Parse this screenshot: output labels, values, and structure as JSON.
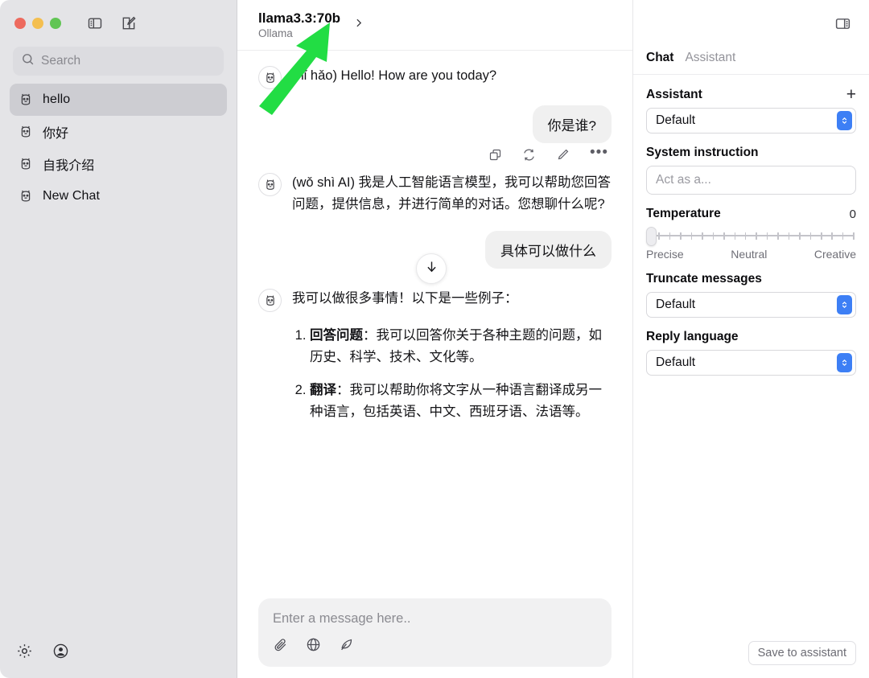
{
  "window": {
    "traffic_lights": [
      "close",
      "minimize",
      "maximize"
    ],
    "toolbar_icons": [
      "sidebar-toggle-icon",
      "compose-icon"
    ]
  },
  "sidebar": {
    "search": {
      "placeholder": "Search",
      "value": "",
      "icon": "search-icon"
    },
    "items": [
      {
        "label": "hello",
        "icon": "llama-icon",
        "active": true
      },
      {
        "label": "你好",
        "icon": "llama-icon",
        "active": false
      },
      {
        "label": "自我介绍",
        "icon": "llama-icon",
        "active": false
      },
      {
        "label": "New Chat",
        "icon": "llama-icon",
        "active": false
      }
    ],
    "footer_icons": [
      "gear-icon",
      "account-icon"
    ]
  },
  "chat_header": {
    "model_name": "llama3.3:70b",
    "provider": "Ollama",
    "chevron": "chevron-right-icon"
  },
  "messages": [
    {
      "role": "assistant",
      "text": "(nǐ hǎo) Hello! How are you today?"
    },
    {
      "role": "user",
      "text": "你是谁?"
    },
    {
      "role": "assistant",
      "text": "(wǒ shì AI) 我是人工智能语言模型，我可以帮助您回答问题，提供信息，并进行简单的对话。您想聊什么呢?",
      "actions": [
        "copy-icon",
        "regenerate-icon",
        "edit-icon",
        "more-options-icon"
      ]
    },
    {
      "role": "user",
      "text": "具体可以做什么"
    },
    {
      "role": "assistant",
      "text": "我可以做很多事情！以下是一些例子：",
      "list": [
        {
          "term": "回答问题",
          "body": "：我可以回答你关于各种主题的问题，如历史、科学、技术、文化等。"
        },
        {
          "term": "翻译",
          "body": "：我可以帮助你将文字从一种语言翻译成另一种语言，包括英语、中文、西班牙语、法语等。"
        }
      ]
    }
  ],
  "scroll_button": {
    "icon": "arrow-down-icon"
  },
  "composer": {
    "placeholder": "Enter a message here..",
    "value": "",
    "icons": [
      "attachment-icon",
      "globe-icon",
      "leaf-icon"
    ]
  },
  "right_panel": {
    "toggle_icon": "right-sidebar-toggle-icon",
    "tabs": [
      {
        "label": "Chat",
        "active": true
      },
      {
        "label": "Assistant",
        "active": false
      }
    ],
    "assistant": {
      "label": "Assistant",
      "add_icon": "plus-icon",
      "selected": "Default"
    },
    "system_instruction": {
      "label": "System instruction",
      "placeholder": "Act as a...",
      "value": ""
    },
    "temperature": {
      "label": "Temperature",
      "value": "0",
      "ticks": 20,
      "knob_percent": 0,
      "legend": [
        "Precise",
        "Neutral",
        "Creative"
      ]
    },
    "truncate": {
      "label": "Truncate messages",
      "selected": "Default"
    },
    "reply_language": {
      "label": "Reply language",
      "selected": "Default"
    },
    "save_button": "Save to assistant"
  },
  "annotation": {
    "type": "arrow",
    "color": "#22dd44",
    "points_to": "llama3.3:70b"
  },
  "colors": {
    "sidebar_bg": "#e4e4e7",
    "sidebar_active": "#cdcdd2",
    "bubble": "#f0f0f0",
    "accent_blue": "#3d7ff5",
    "arrow_green": "#22dd44"
  }
}
